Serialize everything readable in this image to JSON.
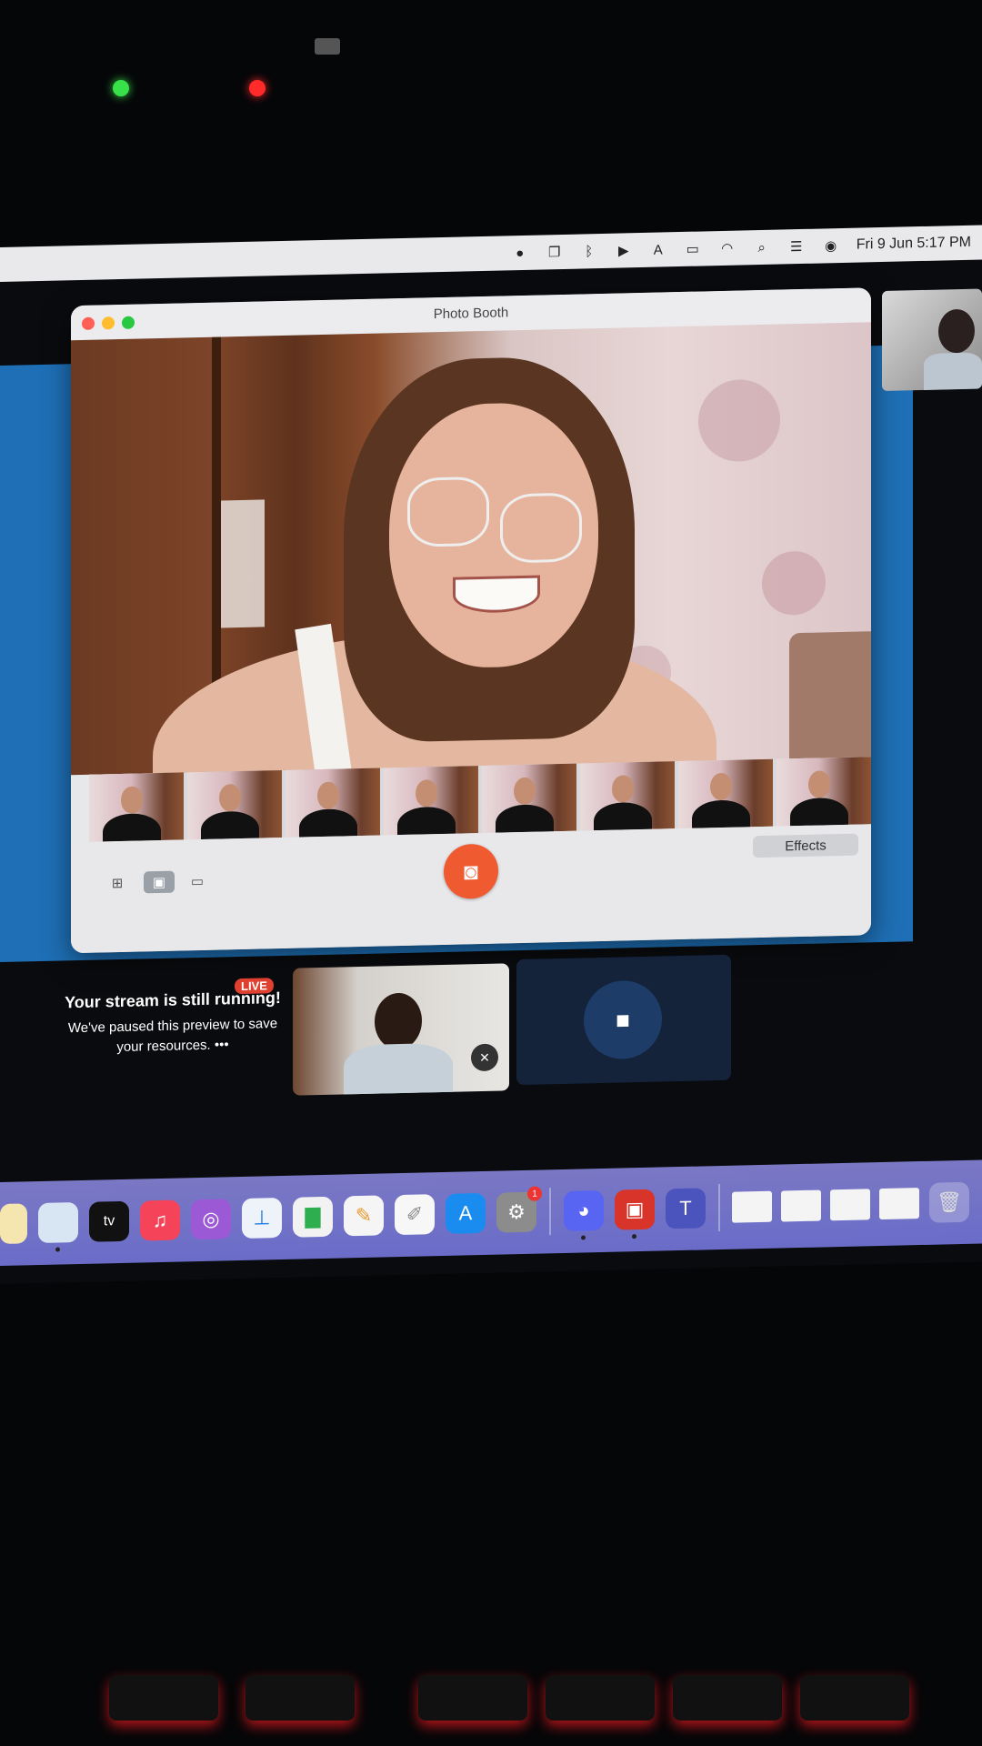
{
  "menubar": {
    "clock": "Fri 9 Jun  5:17 PM",
    "icons": [
      "record-icon",
      "screens-icon",
      "bluetooth-icon",
      "play-icon",
      "keyboard-input-icon",
      "battery-icon",
      "wifi-icon",
      "search-icon",
      "control-center-icon",
      "siri-icon"
    ]
  },
  "photo_booth": {
    "title": "Photo Booth",
    "effects_label": "Effects",
    "thumbnail_count": 8
  },
  "stream": {
    "live_badge": "LIVE",
    "title": "Your stream is still running!",
    "subtitle": "We've paused this preview to save your resources.",
    "more": "•••"
  },
  "dock": {
    "apps": [
      "notes",
      "preview",
      "apple-tv",
      "music",
      "podcasts",
      "keynote",
      "numbers",
      "pages",
      "textedit",
      "app-store",
      "system-settings",
      "discord",
      "photo-booth",
      "teams"
    ],
    "tv_label": "tv",
    "settings_badge": "1"
  },
  "colors": {
    "blue_panel": "#1e6fb5",
    "shutter": "#ef5a31",
    "live": "#e0402f",
    "dock": "#7a78c4"
  }
}
